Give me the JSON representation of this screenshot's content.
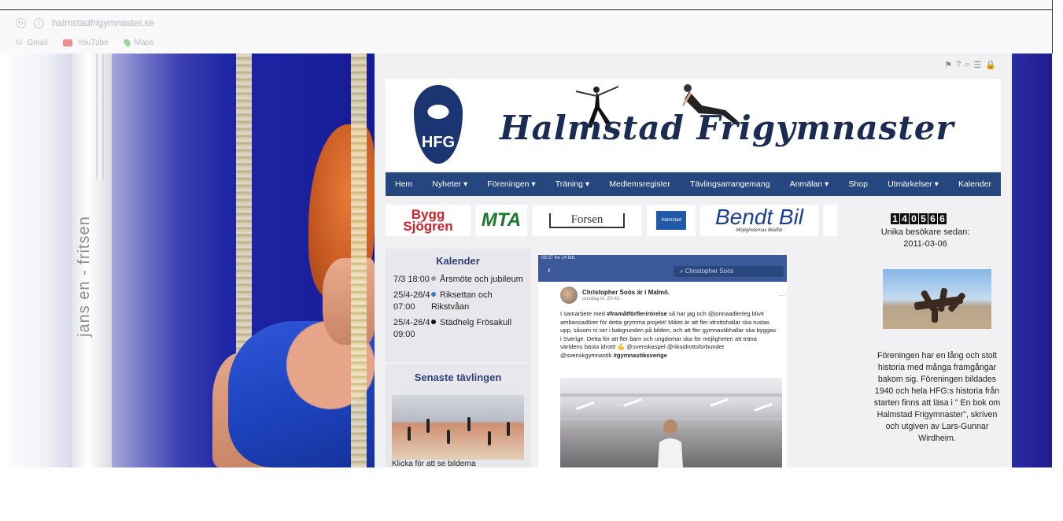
{
  "browser": {
    "url": "halmstadfrigymnaster.se",
    "bookmarks": [
      {
        "label": "Gmail"
      },
      {
        "label": "YouTube"
      },
      {
        "label": "Maps"
      }
    ]
  },
  "left_photo": {
    "strap_label": "jans en - fritsen"
  },
  "header": {
    "shield_text": "HFG",
    "title": "Halmstad Frigymnaster"
  },
  "nav": {
    "items": [
      {
        "label": "Hem"
      },
      {
        "label": "Nyheter ▾"
      },
      {
        "label": "Föreningen ▾"
      },
      {
        "label": "Träning ▾"
      },
      {
        "label": "Medlemsregister"
      },
      {
        "label": "Tävlingsarrangemang"
      },
      {
        "label": "Anmälan ▾"
      },
      {
        "label": "Shop"
      },
      {
        "label": "Utmärkelser ▾"
      },
      {
        "label": "Kalender"
      }
    ]
  },
  "sponsors": {
    "bygg_line1": "Bygg",
    "bygg_line2": "Sjögren",
    "mta": "MTA",
    "forsen": "Forsen",
    "halmstad": "Halmstad",
    "bendt": "Bendt Bil",
    "bendt_sub": "Möjligheternas Bilaffär"
  },
  "counter": {
    "digits": [
      "1",
      "4",
      "0",
      "5",
      "6",
      "6"
    ],
    "label_line1": "Unika besökare sedan:",
    "label_line2": "2011-03-06"
  },
  "kalender": {
    "title": "Kalender",
    "events": [
      {
        "date": "7/3 18:00",
        "title": "Årsmöte och jubileum",
        "dot_color": "#999999"
      },
      {
        "date": "25/4-26/4 07:00",
        "title": "Riksettan och Rikstvåan",
        "dot_color": "#3a7bd5"
      },
      {
        "date": "25/4-26/4 09:00",
        "title": "Städhelg Frösakull",
        "dot_color": "#111111"
      }
    ]
  },
  "senaste": {
    "title": "Senaste tävlingen",
    "caption": "Klicka för att se bilderna"
  },
  "post": {
    "status": "08:37 fre 14 feb.",
    "search": "Christopher Soós",
    "author": "Christopher Soós är i Malmö.",
    "time": "onsdag kl. 20:41 · ",
    "text_before": "I samarbete med ",
    "hashtag1": "#framåtförflerirörelse",
    "text_main": " så har jag och @jonnaadlerteg blivit ambassadörer för detta grymma projekt! Målet är att fler idrottshallar ska rustas upp, såsom ni ser i bakgrunden på bilden, och att fler gymnastikhallar ska byggas i Sverige. Detta för att fler barn och ungdomar ska för möjligheten att träna världens bästa idrott! 💪 @svenskaspel @riksidrottsforbundet @svenskgymnastik ",
    "hashtag2": "#gymnastiksverige"
  },
  "right": {
    "text": "Föreningen har en lång och stolt historia med många framgångar bakom sig.  Föreningen bildades 1940 och hela HFG:s historia från starten finns att läsa i \" En bok om Halmstad Frigymnaster\", skriven och utgiven av Lars-Gunnar Wirdheim."
  },
  "colors": {
    "nav": "#26467f",
    "heading": "#2f3f7a",
    "fb": "#3b5998"
  }
}
